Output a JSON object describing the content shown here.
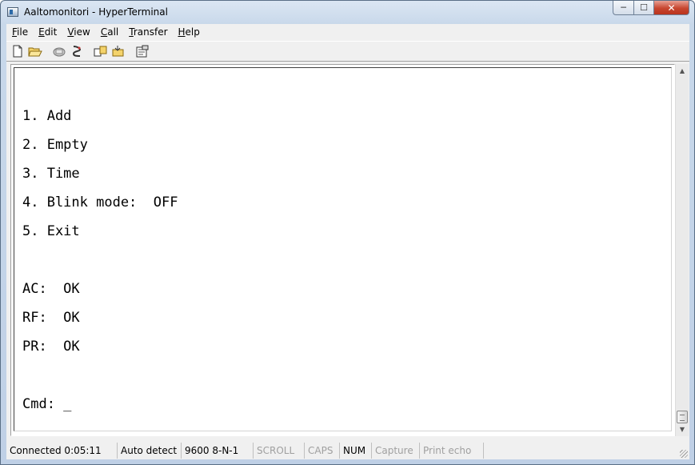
{
  "window": {
    "title": "Aaltomonitori - HyperTerminal",
    "minimize_glyph": "─",
    "maximize_glyph": "☐",
    "close_glyph": "✕"
  },
  "menubar": {
    "items": [
      {
        "underline": "F",
        "rest": "ile"
      },
      {
        "underline": "E",
        "rest": "dit"
      },
      {
        "underline": "V",
        "rest": "iew"
      },
      {
        "underline": "C",
        "rest": "all"
      },
      {
        "underline": "T",
        "rest": "ransfer"
      },
      {
        "underline": "H",
        "rest": "elp"
      }
    ]
  },
  "toolbar": {
    "icons": [
      "new-icon",
      "open-icon",
      "connect-icon",
      "disconnect-icon",
      "send-icon",
      "receive-icon",
      "properties-icon"
    ]
  },
  "terminal": {
    "lines": [
      "1. Add",
      "2. Empty",
      "3. Time",
      "4. Blink mode:  OFF",
      "5. Exit",
      "AC:  OK",
      "RF:  OK",
      "PR:  OK",
      "Cmd: _"
    ]
  },
  "statusbar": {
    "connected": "Connected 0:05:11",
    "detect": "Auto detect",
    "port_settings": "9600 8-N-1",
    "scroll": "SCROLL",
    "caps": "CAPS",
    "num": "NUM",
    "capture": "Capture",
    "print_echo": "Print echo"
  }
}
